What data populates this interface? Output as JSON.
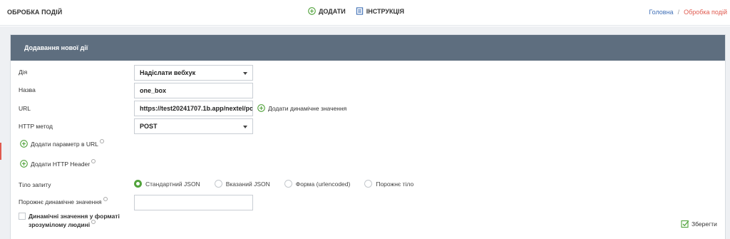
{
  "header": {
    "title": "ОБРОБКА ПОДІЙ",
    "add_label": "ДОДАТИ",
    "instruction_label": "ІНСТРУКЦІЯ",
    "breadcrumb": {
      "home": "Головна",
      "separator": "/",
      "current": "Обробка подій"
    }
  },
  "panel": {
    "title": "Додавання нової дії",
    "fields": {
      "action": {
        "label": "Дія",
        "value": "Надіслати вебхук"
      },
      "name": {
        "label": "Назва",
        "value": "one_box"
      },
      "url": {
        "label": "URL",
        "value": "https://test20241707.1b.app/nextel/po"
      },
      "method": {
        "label": "HTTP метод",
        "value": "POST"
      },
      "empty_dynamic": {
        "label": "Порожнє динамічне значення",
        "value": ""
      }
    },
    "add_dynamic_value": "Додати динамічне значення",
    "add_url_param": "Додати параметр в URL",
    "add_http_header": "Додати HTTP Header",
    "request_body": {
      "label": "Тіло запиту",
      "options": [
        "Стандартний JSON",
        "Вказаний JSON",
        "Форма (urlencoded)",
        "Порожнє тіло"
      ],
      "selected": "Стандартний JSON"
    },
    "human_readable": {
      "label_line1": "Динамічні значення у форматі",
      "label_line2": "зрозумілому людині",
      "checked": false
    },
    "save_label": "Зберегти"
  },
  "colors": {
    "header_bg": "#5e6e7f",
    "accent_green": "#52a33c",
    "link_blue": "#3f6fb6",
    "breadcrumb_red": "#e05a4f"
  }
}
